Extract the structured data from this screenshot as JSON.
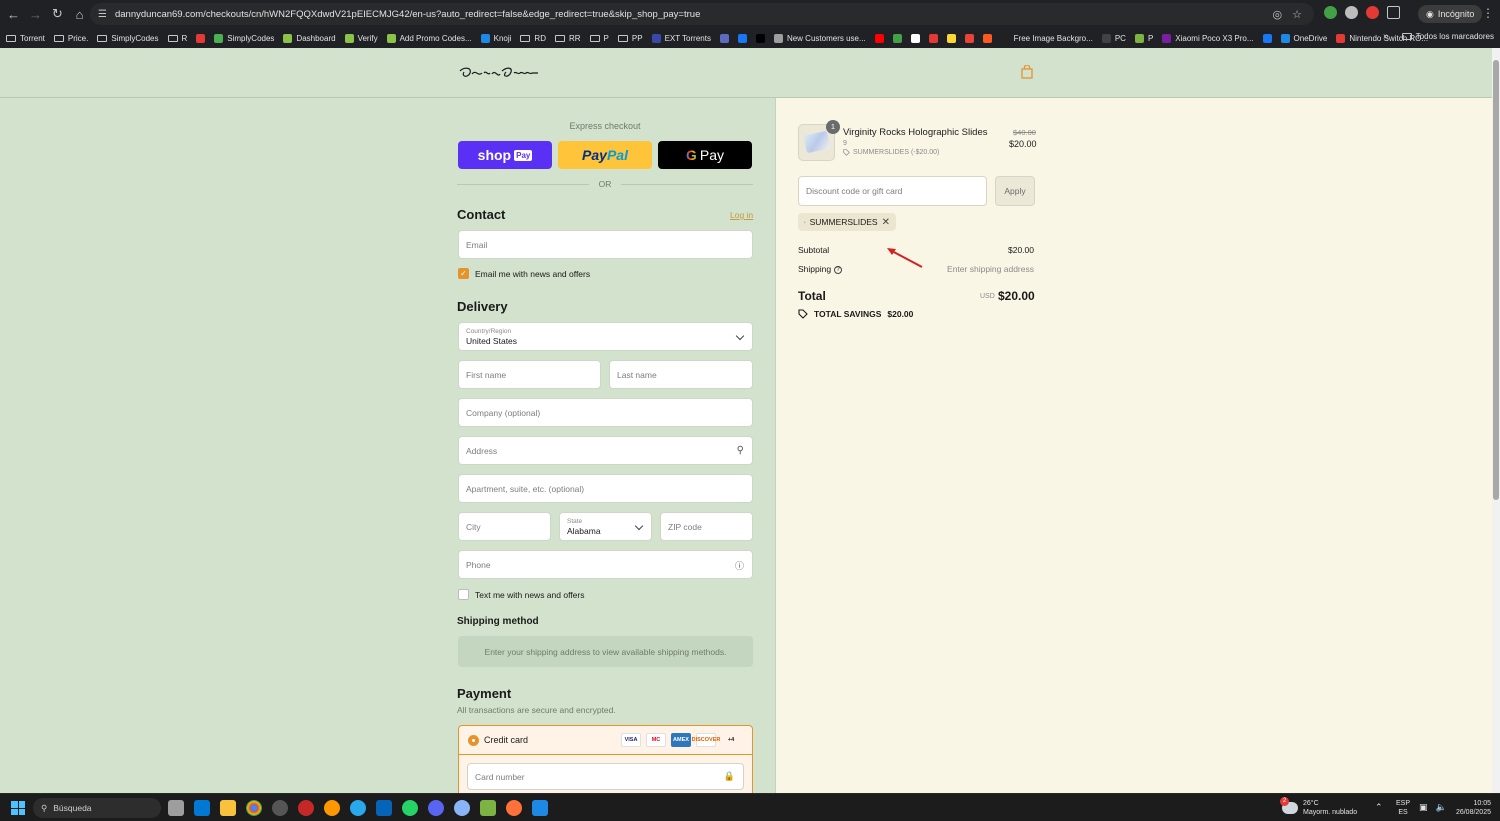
{
  "browser": {
    "url": "dannyduncan69.com/checkouts/cn/hWN2FQQXdwdV21pEIECMJG42/en-us?auto_redirect=false&edge_redirect=true&skip_shop_pay=true",
    "incognito_label": "Incógnito",
    "bookmarks": [
      {
        "label": "Torrent",
        "icon": "folder",
        "color": ""
      },
      {
        "label": "Price.",
        "icon": "folder",
        "color": ""
      },
      {
        "label": "SimplyCodes",
        "icon": "folder",
        "color": ""
      },
      {
        "label": "R",
        "icon": "folder",
        "color": ""
      },
      {
        "label": "",
        "icon": "site",
        "color": "#e53935"
      },
      {
        "label": "SimplyCodes",
        "icon": "site",
        "color": "#4caf50"
      },
      {
        "label": "Dashboard",
        "icon": "site",
        "color": "#8bc34a"
      },
      {
        "label": "Verify",
        "icon": "site",
        "color": "#8bc34a"
      },
      {
        "label": "Add Promo Codes...",
        "icon": "site",
        "color": "#8bc34a"
      },
      {
        "label": "Knoji",
        "icon": "site",
        "color": "#1e88e5"
      },
      {
        "label": "RD",
        "icon": "folder",
        "color": ""
      },
      {
        "label": "RR",
        "icon": "folder",
        "color": ""
      },
      {
        "label": "P",
        "icon": "folder",
        "color": ""
      },
      {
        "label": "PP",
        "icon": "folder",
        "color": ""
      },
      {
        "label": "EXT Torrents",
        "icon": "site",
        "color": "#3949ab"
      },
      {
        "label": "",
        "icon": "site",
        "color": "#5c6bc0"
      },
      {
        "label": "",
        "icon": "site",
        "color": "#1877f2"
      },
      {
        "label": "",
        "icon": "site",
        "color": "#000000"
      },
      {
        "label": "New Customers use...",
        "icon": "site",
        "color": "#9e9e9e"
      },
      {
        "label": "",
        "icon": "site",
        "color": "#ff0000"
      },
      {
        "label": "",
        "icon": "site",
        "color": "#43a047"
      },
      {
        "label": "",
        "icon": "site",
        "color": "#ffffff"
      },
      {
        "label": "",
        "icon": "site",
        "color": "#e53935"
      },
      {
        "label": "",
        "icon": "site",
        "color": "#fdd835"
      },
      {
        "label": "",
        "icon": "site",
        "color": "#ea4335"
      },
      {
        "label": "",
        "icon": "site",
        "color": "#ff5722"
      },
      {
        "label": "Free Image Backgro...",
        "icon": "site",
        "color": "#212121"
      },
      {
        "label": "PC",
        "icon": "site",
        "color": "#424242"
      },
      {
        "label": "P",
        "icon": "site",
        "color": "#7cb342"
      },
      {
        "label": "Xiaomi Poco X3 Pro...",
        "icon": "site",
        "color": "#7b1fa2"
      },
      {
        "label": "",
        "icon": "site",
        "color": "#1877f2"
      },
      {
        "label": "OneDrive",
        "icon": "site",
        "color": "#1e88e5"
      },
      {
        "label": "Nintendo Switch RO...",
        "icon": "site",
        "color": "#e53935"
      }
    ],
    "all_bookmarks_label": "Todos los marcadores"
  },
  "checkout": {
    "express_label": "Express checkout",
    "shop_pay": {
      "brand": "shop",
      "tag": "Pay"
    },
    "paypal": {
      "part1": "Pay",
      "part2": "Pal"
    },
    "gpay": {
      "g": "G",
      "label": "Pay"
    },
    "or_label": "OR",
    "contact_title": "Contact",
    "login_label": "Log in",
    "email_placeholder": "Email",
    "email_news_label": "Email me with news and offers",
    "delivery_title": "Delivery",
    "country_label": "Country/Region",
    "country_value": "United States",
    "first_name_placeholder": "First name",
    "last_name_placeholder": "Last name",
    "company_placeholder": "Company (optional)",
    "address_placeholder": "Address",
    "apartment_placeholder": "Apartment, suite, etc. (optional)",
    "city_placeholder": "City",
    "state_label": "State",
    "state_value": "Alabama",
    "zip_placeholder": "ZIP code",
    "phone_placeholder": "Phone",
    "text_news_label": "Text me with news and offers",
    "shipping_method_title": "Shipping method",
    "shipping_notice": "Enter your shipping address to view available shipping methods.",
    "payment_title": "Payment",
    "payment_subtitle": "All transactions are secure and encrypted.",
    "credit_card_label": "Credit card",
    "card_logos": [
      {
        "name": "VISA",
        "bg": "#ffffff",
        "fg": "#1a1f71"
      },
      {
        "name": "MC",
        "bg": "#ffffff",
        "fg": "#eb001b"
      },
      {
        "name": "AMEX",
        "bg": "#2e77bc",
        "fg": "#ffffff"
      },
      {
        "name": "DISCOVER",
        "bg": "#ffffff",
        "fg": "#e65c00"
      },
      {
        "name": "+4",
        "bg": "#fff2e6",
        "fg": "#1a1a1a"
      }
    ],
    "card_number_placeholder": "Card number"
  },
  "summary": {
    "quantity": "1",
    "product_name": "Virginity Rocks Holographic Slides",
    "variant": "9",
    "item_discount": "SUMMERSLIDES (-$20.00)",
    "old_price": "$40.00",
    "new_price": "$20.00",
    "discount_placeholder": "Discount code or gift card",
    "apply_label": "Apply",
    "applied_code": "SUMMERSLIDES",
    "subtotal_label": "Subtotal",
    "subtotal_value": "$20.00",
    "shipping_label": "Shipping",
    "shipping_value": "Enter shipping address",
    "total_label": "Total",
    "currency": "USD",
    "total_value": "$20.00",
    "savings_label": "TOTAL SAVINGS",
    "savings_value": "$20.00"
  },
  "taskbar": {
    "search_label": "Búsqueda",
    "weather_temp": "26°C",
    "weather_desc": "Mayorm. nublado",
    "lang_top": "ESP",
    "lang_bottom": "ES",
    "time": "10:05",
    "date": "26/08/2025",
    "weather_badge": "2"
  },
  "colors": {
    "page_bg": "#d2e2cd",
    "summary_bg": "#faf6e6",
    "accent": "#e4932d",
    "shop_pay": "#5a31f4",
    "paypal": "#ffc439"
  }
}
